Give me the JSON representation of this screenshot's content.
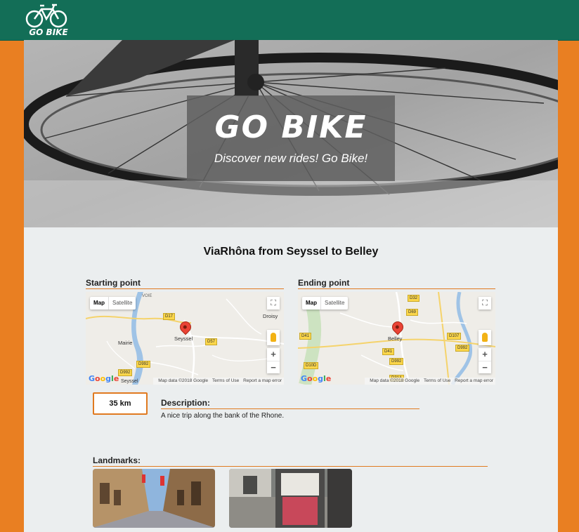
{
  "header": {
    "logo_text": "GO BIKE",
    "logo_icon": "bicycle-icon"
  },
  "hero": {
    "title": "GO BIKE",
    "subtitle": "Discover new rides! Go Bike!"
  },
  "ride": {
    "title": "ViaRhôna from Seyssel to Belley",
    "starting_point_label": "Starting point",
    "ending_point_label": "Ending point",
    "distance": "35 km",
    "description_label": "Description:",
    "description": "A nice trip along the bank of the Rhone.",
    "landmarks_label": "Landmarks:"
  },
  "map_start": {
    "map_tab": "Map",
    "satellite_tab": "Satellite",
    "place_main": "Seyssel",
    "place_2": "Droisy",
    "place_3": "Mairie",
    "place_4": "Seyssel",
    "place_5": "VOIE",
    "roads": [
      "D17",
      "D57",
      "D992",
      "D992"
    ],
    "attribution": "Map data ©2018 Google",
    "terms": "Terms of Use",
    "report": "Report a map error",
    "google": "Google"
  },
  "map_end": {
    "map_tab": "Map",
    "satellite_tab": "Satellite",
    "place_main": "Belley",
    "roads": [
      "D32",
      "D69",
      "D41",
      "D10D",
      "D992",
      "D41",
      "D107",
      "D992",
      "D31A"
    ],
    "attribution": "Map data ©2018 Google",
    "terms": "Terms of Use",
    "report": "Report a map error",
    "google": "Google"
  },
  "colors": {
    "header_bg": "#136e57",
    "accent_orange": "#e97f22",
    "content_bg": "#ebeeef"
  }
}
